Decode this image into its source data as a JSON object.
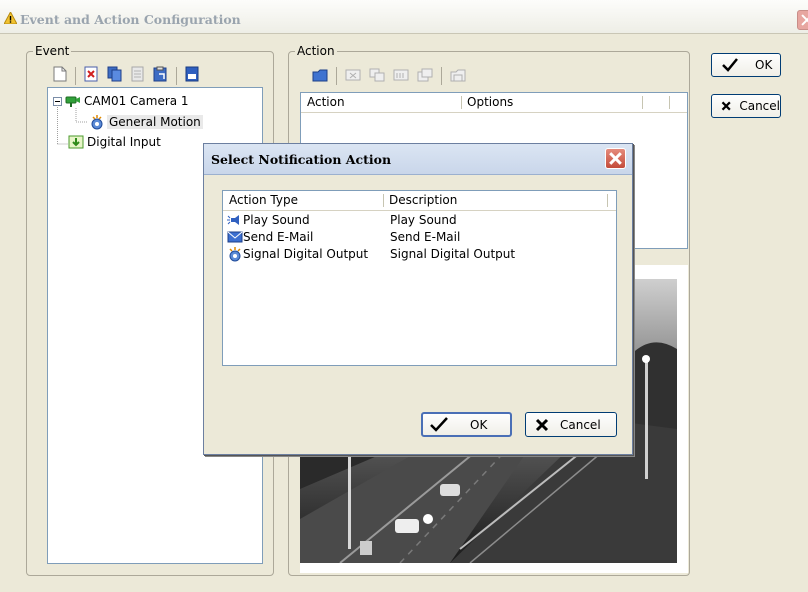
{
  "window": {
    "title": "Event and Action Configuration"
  },
  "event_panel": {
    "legend": "Event",
    "toolbar_icons": [
      "new-icon",
      "delete-icon",
      "copy-icon",
      "disabled-icon",
      "paste-icon",
      "properties-icon"
    ],
    "tree": [
      {
        "label": "CAM01 Camera 1",
        "icon": "camera-icon"
      },
      {
        "label": "General Motion",
        "icon": "motion-icon"
      },
      {
        "label": "Digital Input",
        "icon": "digital-input-icon"
      }
    ]
  },
  "action_panel": {
    "legend": "Action",
    "columns": [
      "Action",
      "Options"
    ]
  },
  "buttons": {
    "ok": "OK",
    "cancel": "Cancel"
  },
  "dialog": {
    "title": "Select Notification Action",
    "columns": [
      "Action Type",
      "Description"
    ],
    "rows": [
      {
        "type": "Play Sound",
        "description": "Play Sound",
        "icon": "speaker-icon"
      },
      {
        "type": "Send E-Mail",
        "description": "Send E-Mail",
        "icon": "email-icon"
      },
      {
        "type": "Signal Digital Output",
        "description": "Signal Digital Output",
        "icon": "alarm-output-icon"
      }
    ],
    "ok": "OK",
    "cancel": "Cancel"
  },
  "colors": {
    "title_text": "#9aa4ae",
    "selection_border": "#316ac5",
    "list_border": "#7f9db9"
  }
}
